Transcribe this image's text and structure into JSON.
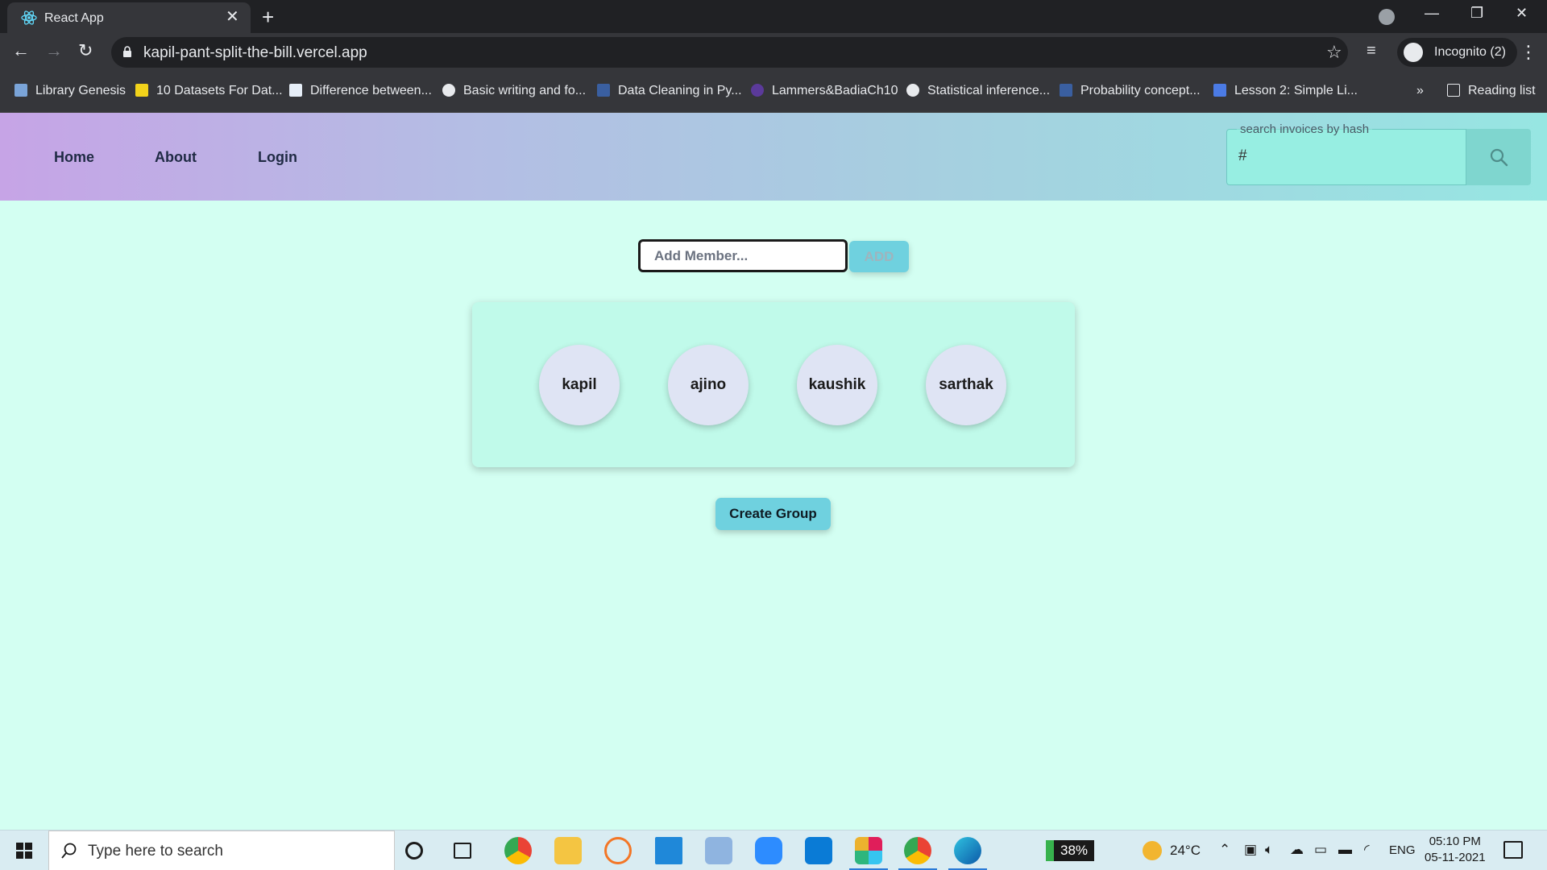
{
  "browser": {
    "tab_title": "React App",
    "url": "kapil-pant-split-the-bill.vercel.app",
    "profile_label": "Incognito (2)",
    "bookmarks": [
      "Library Genesis",
      "10 Datasets For Dat...",
      "Difference between...",
      "Basic writing and fo...",
      "Data Cleaning in Py...",
      "Lammers&BadiaCh10",
      "Statistical inference...",
      "Probability concept...",
      "Lesson 2: Simple Li..."
    ],
    "reading_list": "Reading list",
    "more_bookmarks": "»"
  },
  "header": {
    "nav": [
      "Home",
      "About",
      "Login"
    ],
    "search_label": "search invoices by hash",
    "search_value": "#",
    "search_icon": "search-icon",
    "gradient": [
      "#c6a4e6",
      "#97e6e2"
    ]
  },
  "main": {
    "add_member_placeholder": "Add Member...",
    "add_button": "ADD",
    "members": [
      "kapil",
      "ajino",
      "kaushik",
      "sarthak"
    ],
    "create_group_button": "Create Group",
    "background": "#d3fff2",
    "accent": "#6fd1df"
  },
  "taskbar": {
    "search_placeholder": "Type here to search",
    "battery": "38%",
    "temperature": "24°C",
    "language": "ENG",
    "time": "05:10 PM",
    "date": "05-11-2021"
  }
}
